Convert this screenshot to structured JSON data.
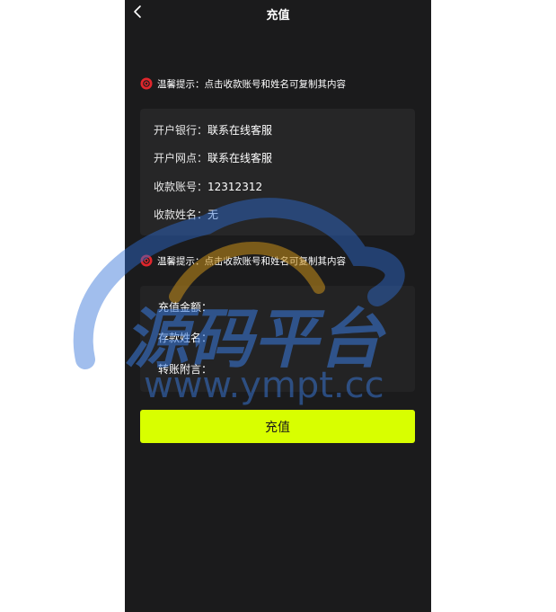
{
  "header": {
    "title": "充值"
  },
  "tips": [
    {
      "text": "温馨提示：点击收款账号和姓名可复制其内容"
    },
    {
      "text": "温馨提示：点击收款账号和姓名可复制其内容"
    }
  ],
  "bank_info": {
    "rows": [
      {
        "label": "开户银行：",
        "value": "联系在线客服"
      },
      {
        "label": "开户网点：",
        "value": "联系在线客服"
      },
      {
        "label": "收款账号：",
        "value": "12312312"
      },
      {
        "label": "收款姓名：",
        "value": "无"
      }
    ]
  },
  "form": {
    "fields": [
      {
        "label": "充值金额：",
        "value": ""
      },
      {
        "label": "存款姓名：",
        "value": ""
      },
      {
        "label": "转账附言：",
        "value": ""
      }
    ]
  },
  "submit": {
    "label": "充值"
  },
  "watermark": {
    "brand": "源码平台",
    "url": "www.ympt.cc"
  },
  "colors": {
    "page_bg": "#1b1b1c",
    "card_bg": "#262627",
    "accent_button": "#d8ff00",
    "tip_icon": "#e0262c",
    "watermark_blue": "#2f6fd6",
    "watermark_gold": "#c8901a"
  },
  "icons": {
    "back": "chevron-left-icon",
    "tip": "alert-badge-icon"
  }
}
